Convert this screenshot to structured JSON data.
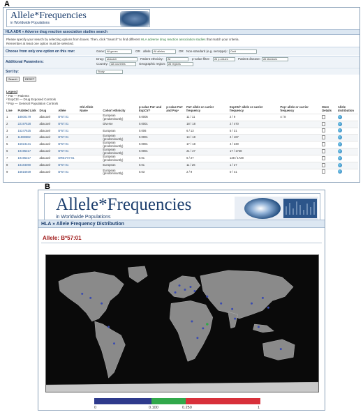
{
  "panel_a": {
    "letter": "A",
    "logo": {
      "title": "Allele*Frequencies",
      "subtitle": "in Worldwide Populations"
    },
    "breadcrumb": "HLA ADR » Adverse drug reaction association studies search",
    "instructions": {
      "line1a": "Please specify your search by selecting options from boxes. Then, click \"Search\" to find different",
      "line1_link": "HLA adverse drug reaction association studies",
      "line1b": "that match your criteria.",
      "line2": "Remember at least one option must be selected."
    },
    "choose_row": {
      "label": "Choose from only one option on this row:",
      "gene_label": "Gene:",
      "gene_value": "All genes",
      "or1": "OR",
      "allele_label": "allele:",
      "allele_value": "All alleles",
      "or2": "OR",
      "nonstd_label": "Non-standard (e.g. serotype):",
      "nonstd_value": "Omit"
    },
    "additional": {
      "label": "Additional Parameters:",
      "drug_label": "Drug:",
      "drug_value": "abacavir",
      "ethnicity_label": "Patient ethnicity:",
      "ethnicity_value": "All",
      "pfilter_label": "p-value filter:",
      "pfilter_value": "All p-values",
      "disease_label": "Patient disease:",
      "disease_value": "All diseases",
      "country_label": "Country:",
      "country_value": "All countries",
      "region_label": "Geographic region:",
      "region_value": "All regions"
    },
    "sort": {
      "label": "Sort by:",
      "value": "Study"
    },
    "buttons": {
      "search": "Search",
      "reset": "RESET"
    },
    "legend": {
      "title": "Legend",
      "items": [
        "¹ Pat — Patients",
        "² ExpCtrl — Drug Exposed Controls",
        "³ Pop — General Population Controls"
      ]
    },
    "table": {
      "headers": [
        "Line",
        "PubMed Link",
        "Drug",
        "Allele",
        "Old Allele Name",
        "Cohort ethnicity",
        "p-value Pat¹ and ExpCtrl²",
        "p-value Pat¹ and Pop³",
        "Pat¹ allele or carrier frequency",
        "ExpCtrl² allele or carrier frequency",
        "Pop³ allele or carrier frequency",
        "More Details",
        "Allele distribution"
      ],
      "rows": [
        [
          "1",
          "18500179",
          "abacavir",
          "B*57:01",
          "",
          "European (predominantly)",
          "0.0005",
          "",
          "11 / 11",
          "2 / 9",
          "4 / 8"
        ],
        [
          "2",
          "22197528",
          "abacavir",
          "B*57:01",
          "",
          "Diverse",
          "0.0001",
          "",
          "18 / 18",
          "2 / 470",
          ""
        ],
        [
          "3",
          "15247625",
          "abacavir",
          "B*57:01",
          "",
          "European",
          "0.006",
          "",
          "6 / 13",
          "5 / 31",
          ""
        ],
        [
          "4",
          "11888582",
          "abacavir",
          "B*57:01",
          "",
          "European (predominantly)",
          "0.0001",
          "",
          "14 / 18",
          "4 / 167",
          ""
        ],
        [
          "5",
          "15024131",
          "abacavir",
          "B*57:01",
          "",
          "European (predominantly)",
          "0.0001",
          "",
          "17 / 18",
          "4 / 230",
          ""
        ],
        [
          "6",
          "19195317",
          "abacavir",
          "B*57:01",
          "",
          "European (predominantly)",
          "0.0001",
          "",
          "21 / 27",
          "17 / 1728",
          ""
        ],
        [
          "7",
          "19195317",
          "abacavir",
          "DRB1*07:01",
          "",
          "European (predominantly)",
          "0.01",
          "",
          "6 / 27",
          "138 / 1728",
          ""
        ],
        [
          "8",
          "18184080",
          "abacavir",
          "B*57:01",
          "",
          "European",
          "0.01",
          "",
          "11 / 26",
          "1 / 27",
          ""
        ],
        [
          "9",
          "16816939",
          "abacavir",
          "B*57:01",
          "",
          "European (predominantly)",
          "0.03",
          "",
          "2 / 9",
          "0 / 41",
          ""
        ]
      ]
    }
  },
  "panel_b": {
    "letter": "B",
    "logo": {
      "title": "Allele*Frequencies",
      "subtitle": "in Worldwide Populations"
    },
    "breadcrumb": "HLA » Allele Frequency Distribution",
    "allele_heading": "Allele: B*57:01",
    "scale": {
      "ticks": [
        "0",
        "0.100",
        "0.250",
        "1"
      ],
      "colors": [
        "#2e3a8c",
        "#31a84a",
        "#d8303a"
      ]
    }
  }
}
